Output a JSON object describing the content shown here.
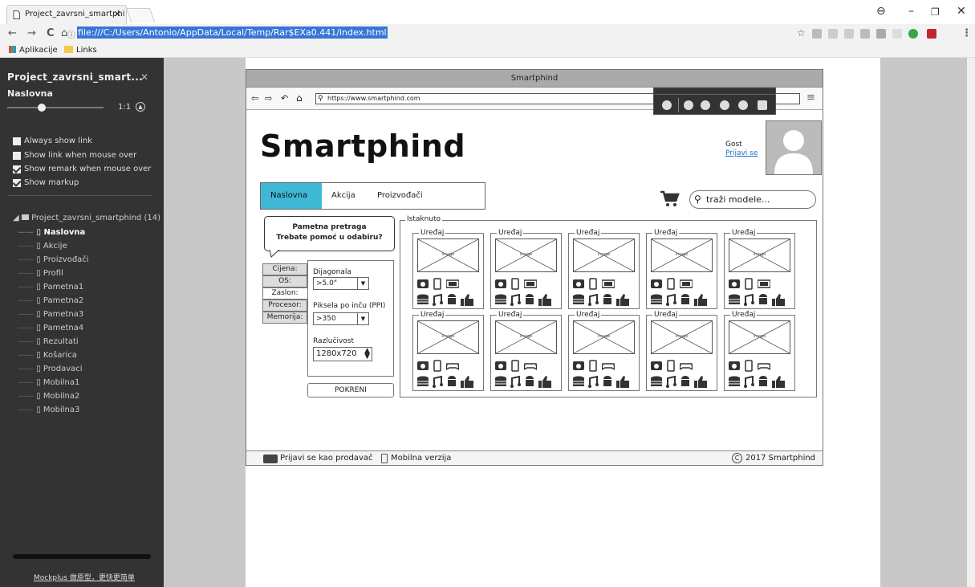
{
  "browser": {
    "tab_title": "Project_zavrsni_smartphi",
    "url_highlight": "file:///C:/Users/Antonio/AppData/Local/Temp/Rar$EXa0.441/index.html",
    "bookmarks": [
      "Aplikacije",
      "Links"
    ]
  },
  "sidebar": {
    "project_title": "Project_zavrsni_smart...",
    "page_name": "Naslovna",
    "zoom_label": "1:1",
    "options": [
      {
        "label": "Always show link",
        "checked": false
      },
      {
        "label": "Show link when mouse over",
        "checked": false
      },
      {
        "label": "Show remark when mouse over",
        "checked": true
      },
      {
        "label": "Show markup",
        "checked": true
      }
    ],
    "tree_root": "Project_zavrsni_smartphind (14)",
    "pages": [
      "Naslovna",
      "Akcije",
      "Proizvođači",
      "Profil",
      "Pametna1",
      "Pametna2",
      "Pametna3",
      "Pametna4",
      "Rezultati",
      "Košarica",
      "Prodavaci",
      "Mobilna1",
      "Mobilna2",
      "Mobilna3"
    ],
    "footer": "Mockplus 做原型，更快更简单"
  },
  "mockup": {
    "window_title": "Smartphind",
    "address": "https://www.smartphind.com",
    "logo": "Smartphind",
    "user": "Gost",
    "login_link": "Prijavi se",
    "menu": [
      "Naslovna",
      "Akcija",
      "Proizvođači"
    ],
    "search_placeholder": "traži modele...",
    "bubble_line1": "Pametna pretraga",
    "bubble_line2": "Trebate pomoć u odabiru?",
    "filter_tabs": [
      "Cijena:",
      "OS:",
      "Zaslon:",
      "Procesor:",
      "Memorija:"
    ],
    "diag_label": "Dijagonala",
    "diag_value": ">5.0\"",
    "ppi_label": "Piksela po inču (PPI)",
    "ppi_value": ">350",
    "res_label": "Razlučivost",
    "res_value": "1280x720",
    "run_button": "POKRENI",
    "featured_label": "Istaknuto",
    "card_label": "Uređaj",
    "image_text": "Image",
    "footer_seller": "Prijavi se kao prodavač",
    "footer_mobile": "Mobilna verzija",
    "footer_copy": "2017 Smartphind"
  }
}
